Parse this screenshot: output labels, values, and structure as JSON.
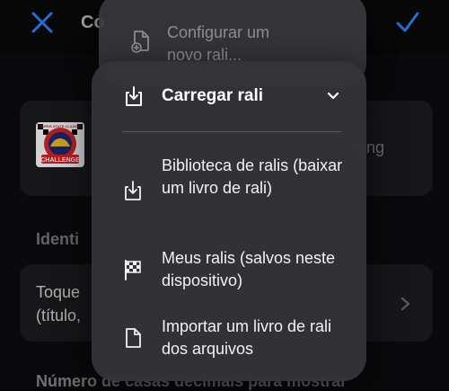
{
  "background": {
    "title": "Co",
    "side_text": "ring",
    "section_header": "Identi",
    "row_text": "Toque\n(título,",
    "bottom_text": "Número de casas decimais para mostrar",
    "logo": {
      "top_text": "SUPER STATE CLASSIC",
      "bottom_text": "CHALLENGE"
    },
    "accent_color": "#2f87ff"
  },
  "back_menu": {
    "label": "Configurar um novo rali...",
    "icon": "document-plus-icon"
  },
  "menu": {
    "header": {
      "label": "Carregar rali",
      "icon": "download-tray-icon"
    },
    "items": [
      {
        "label": "Biblioteca de ralis (baixar um livro de rali)",
        "icon": "download-tray-icon"
      },
      {
        "label": "Meus ralis (salvos neste dispositivo)",
        "icon": "checkered-flag-icon"
      },
      {
        "label": "Importar um livro de rali dos arquivos",
        "icon": "document-icon"
      }
    ]
  }
}
